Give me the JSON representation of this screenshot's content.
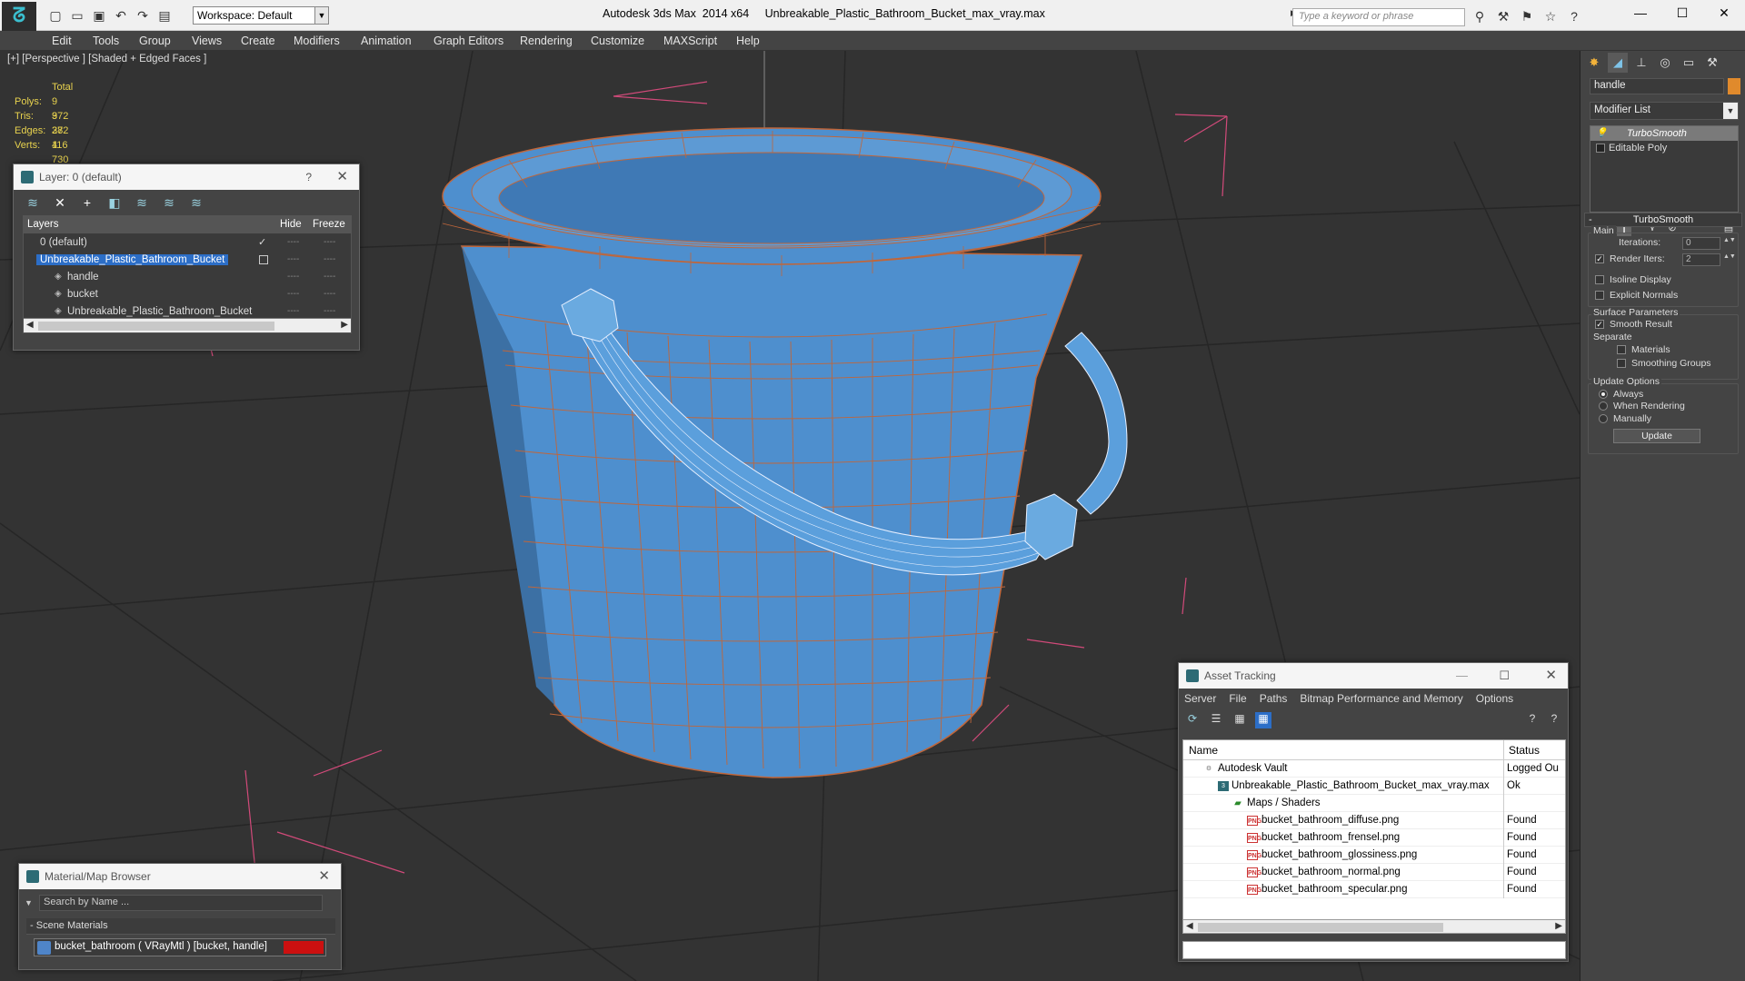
{
  "titlebar": {
    "workspace": "Workspace: Default",
    "app_name": "Autodesk 3ds Max  2014 x64",
    "file_name": "Unbreakable_Plastic_Bathroom_Bucket_max_vray.max",
    "search_placeholder": "Type a keyword or phrase",
    "quick_access_icons": [
      "logo-icon",
      "new-icon",
      "open-icon",
      "save-icon",
      "undo-icon",
      "redo-icon",
      "project-folder-icon"
    ],
    "right_icons": [
      "binoculars-icon",
      "tools-icon",
      "share-icon",
      "star-icon",
      "help-icon"
    ]
  },
  "menu": [
    "Edit",
    "Tools",
    "Group",
    "Views",
    "Create",
    "Modifiers",
    "Animation",
    "Graph Editors",
    "Rendering",
    "Customize",
    "MAXScript",
    "Help"
  ],
  "viewport": {
    "label": "[+] [Perspective ] [Shaded + Edged Faces ]",
    "stats": {
      "total_label": "Total",
      "rows": [
        {
          "k": "Polys:",
          "v": "9 372"
        },
        {
          "k": "Tris:",
          "v": "9 372"
        },
        {
          "k": "Edges:",
          "v": "28 116"
        },
        {
          "k": "Verts:",
          "v": "4 730"
        }
      ]
    },
    "colors": {
      "background": "#333333",
      "bucket": "#4e8fce",
      "edges": "#c0663a",
      "grid": "#222222",
      "gizmo": "#d24a7a"
    }
  },
  "layer_dialog": {
    "title": "Layer: 0 (default)",
    "help": "?",
    "close": "✕",
    "toolbar_icons": [
      "create-layer-icon",
      "delete-layer-icon",
      "add-to-layer-icon",
      "select-in-layer-icon",
      "highlight-layer-icon",
      "hide-all-layers-icon",
      "freeze-all-layers-icon"
    ],
    "headers": {
      "layers": "Layers",
      "hide": "Hide",
      "freeze": "Freeze"
    },
    "rows": [
      {
        "name": "0 (default)",
        "indent": 0,
        "selected": false,
        "active": true
      },
      {
        "name": "Unbreakable_Plastic_Bathroom_Bucket",
        "indent": 0,
        "selected": true,
        "active": false
      },
      {
        "name": "handle",
        "indent": 1,
        "selected": false,
        "active": false
      },
      {
        "name": "bucket",
        "indent": 1,
        "selected": false,
        "active": false
      },
      {
        "name": "Unbreakable_Plastic_Bathroom_Bucket",
        "indent": 1,
        "selected": false,
        "active": false
      }
    ],
    "dash": "----"
  },
  "material_browser": {
    "title": "Material/Map Browser",
    "close": "✕",
    "search_placeholder": "Search by Name ...",
    "section": "Scene Materials",
    "item": "bucket_bathroom  ( VRayMtl )  [bucket, handle]",
    "swatch_color": "#cc1010"
  },
  "asset_tracking": {
    "title": "Asset Tracking",
    "menu": [
      "Server",
      "File",
      "Paths",
      "Bitmap Performance and Memory",
      "Options"
    ],
    "toolbar_icons": [
      "refresh-icon",
      "list-icon",
      "thumbnail-icon",
      "table-icon",
      "help-icon",
      "vault-help-icon"
    ],
    "headers": {
      "name": "Name",
      "status": "Status"
    },
    "rows": [
      {
        "name": "Autodesk Vault",
        "status": "Logged Ou",
        "indent": 1,
        "icon": "vault-icon"
      },
      {
        "name": "Unbreakable_Plastic_Bathroom_Bucket_max_vray.max",
        "status": "Ok",
        "indent": 2,
        "icon": "max-file-icon"
      },
      {
        "name": "Maps / Shaders",
        "status": "",
        "indent": 3,
        "icon": "maps-icon"
      },
      {
        "name": "bucket_bathroom_diffuse.png",
        "status": "Found",
        "indent": 4,
        "icon": "png-icon"
      },
      {
        "name": "bucket_bathroom_frensel.png",
        "status": "Found",
        "indent": 4,
        "icon": "png-icon"
      },
      {
        "name": "bucket_bathroom_glossiness.png",
        "status": "Found",
        "indent": 4,
        "icon": "png-icon"
      },
      {
        "name": "bucket_bathroom_normal.png",
        "status": "Found",
        "indent": 4,
        "icon": "png-icon"
      },
      {
        "name": "bucket_bathroom_specular.png",
        "status": "Found",
        "indent": 4,
        "icon": "png-icon"
      }
    ]
  },
  "command_panel": {
    "tabs": [
      "create-icon",
      "modify-icon",
      "hierarchy-icon",
      "motion-icon",
      "display-icon",
      "utilities-icon"
    ],
    "object_name": "handle",
    "object_color": "#e08a2c",
    "modifier_list": "Modifier List",
    "stack": [
      "TurboSmooth",
      "Editable Poly"
    ],
    "rollout": "TurboSmooth",
    "main_label": "Main",
    "iterations_label": "Iterations:",
    "iterations_value": "0",
    "render_iters_label": "Render Iters:",
    "render_iters_value": "2",
    "render_iters_checked": true,
    "isoline_label": "Isoline Display",
    "explicit_normals_label": "Explicit Normals",
    "surface_label": "Surface Parameters",
    "smooth_result_label": "Smooth Result",
    "separate_label": "Separate",
    "materials_label": "Materials",
    "smoothing_groups_label": "Smoothing Groups",
    "update_options_label": "Update Options",
    "always_label": "Always",
    "when_rendering_label": "When Rendering",
    "manually_label": "Manually",
    "update_button": "Update",
    "update_mode": "Always"
  }
}
